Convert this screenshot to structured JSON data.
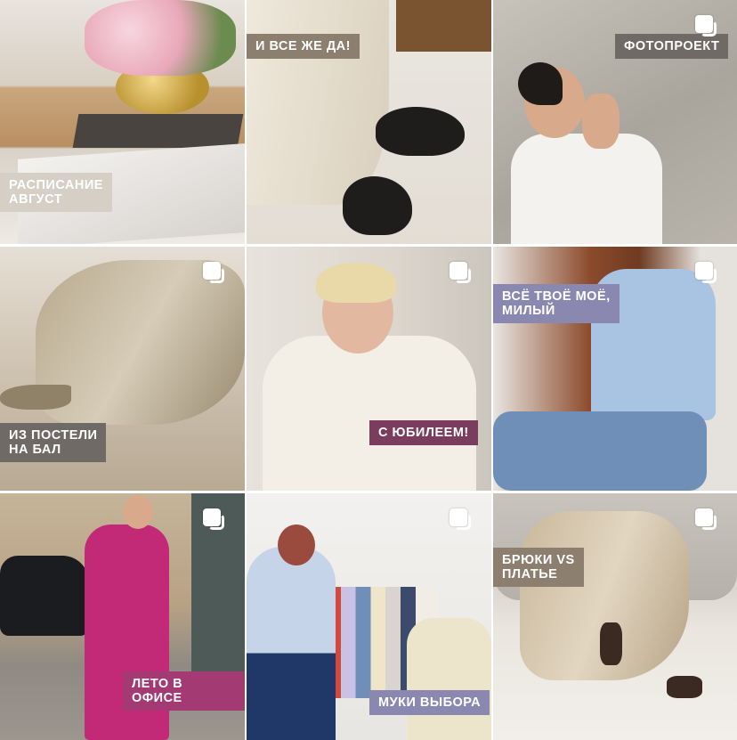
{
  "colors": {
    "caption_gray": "#6f6a66",
    "caption_plum": "#7b3d5e",
    "caption_pink": "#a33a73",
    "caption_lilac": "#8a88b0",
    "caption_beige": "#8c7f70"
  },
  "tiles": [
    {
      "caption": "РАСПИСАНИЕ\nАВГУСТ",
      "multi": false
    },
    {
      "caption": "И ВСЕ ЖЕ ДА!",
      "multi": false
    },
    {
      "caption": "ФОТОПРОЕКТ",
      "multi": true
    },
    {
      "caption": "ИЗ ПОСТЕЛИ\nНА БАЛ",
      "multi": true
    },
    {
      "caption": "С ЮБИЛЕЕМ!",
      "multi": true
    },
    {
      "caption": "ВСЁ ТВОЁ МОЁ,\nМИЛЫЙ",
      "multi": true
    },
    {
      "caption": "",
      "multi": true
    },
    {
      "caption": "ЛЕТО В ОФИСЕ",
      "multi": true
    },
    {
      "caption": "МУКИ ВЫБОРА",
      "multi": true
    },
    {
      "caption": "БРЮКИ VS\nПЛАТЬЕ",
      "multi": true
    }
  ]
}
